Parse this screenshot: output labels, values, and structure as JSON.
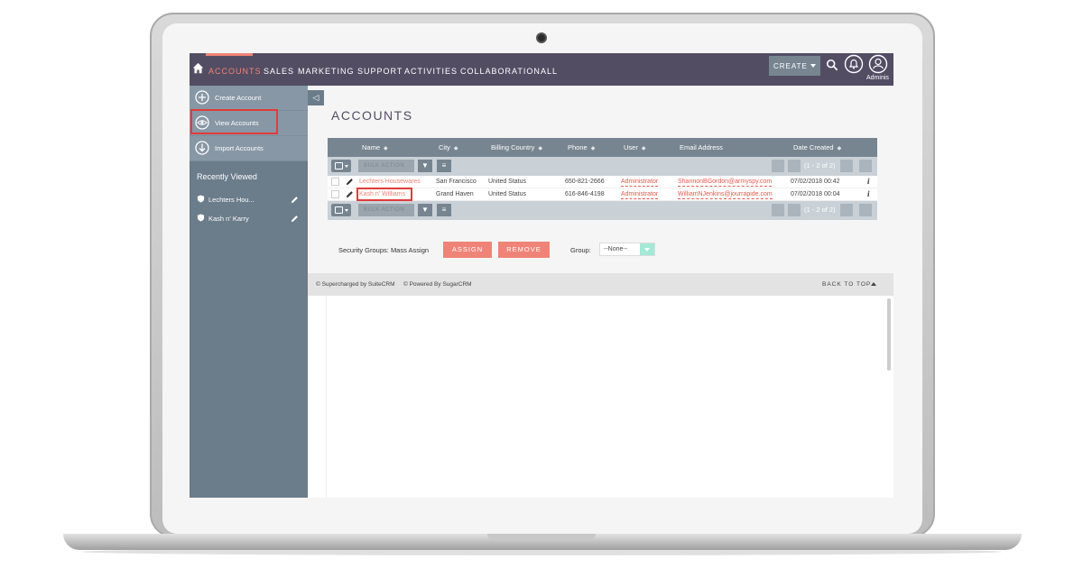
{
  "nav": {
    "items": [
      "ACCOUNTS",
      "SALES",
      "MARKETING",
      "SUPPORT",
      "ACTIVITIES",
      "COLLABORATION",
      "ALL"
    ],
    "create_label": "CREATE",
    "user_label": "Adminis",
    "accent_color": "#f08377",
    "bar_color": "#534d64"
  },
  "sidebar": {
    "actions": [
      {
        "label": "Create Account",
        "icon": "plus-circle-icon"
      },
      {
        "label": "View Accounts",
        "icon": "eye-icon"
      },
      {
        "label": "Import Accounts",
        "icon": "download-circle-icon"
      }
    ],
    "recent_title": "Recently Viewed",
    "recent_items": [
      "Lechters Hou...",
      "Kash n' Karry"
    ]
  },
  "main": {
    "title": "ACCOUNTS",
    "columns": [
      "Name",
      "City",
      "Billing Country",
      "Phone",
      "User",
      "Email Address",
      "Date Created"
    ],
    "bulk_action_label": "BULK ACTION",
    "pagination": "(1 - 2 of 2)",
    "rows": [
      {
        "name": "Lechters Housewares",
        "city": "San Francisco",
        "country": "United Status",
        "phone": "650-821-2666",
        "user": "Administrator",
        "email": "ShannonBGordon@armyspy.com",
        "date": "07/02/2018 00:42"
      },
      {
        "name": "Kash n' Williams",
        "city": "Grand Haven",
        "country": "United Status",
        "phone": "616-846-4198",
        "user": "Administrator",
        "email": "WilliamNJenkins@jourrapide.com",
        "date": "07/02/2018 00:04"
      }
    ],
    "mass_assign_label": "Security Groups: Mass Assign",
    "assign_label": "ASSIGN",
    "remove_label": "REMOVE",
    "group_label": "Group:",
    "group_value": "--None--"
  },
  "footer": {
    "supercharged": "© Supercharged by SuiteCRM",
    "powered": "© Powered By SugarCRM",
    "back_to_top": "BACK TO TOP"
  }
}
